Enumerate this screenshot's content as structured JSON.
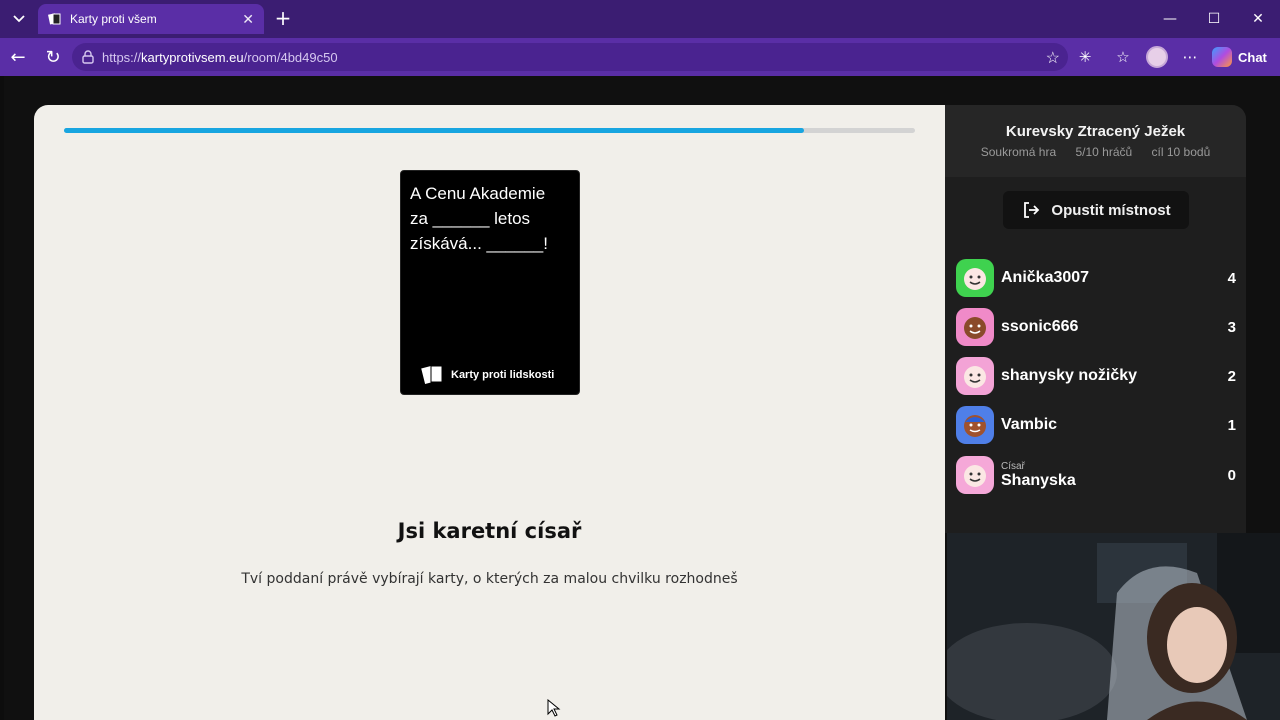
{
  "browser": {
    "tab_title": "Karty proti všem",
    "url_prefix": "https://",
    "url_host": "kartyprotivsem.eu",
    "url_path": "/room/4bd49c50",
    "chat_label": "Chat"
  },
  "game": {
    "progress": 0.87,
    "black_card_text": "A Cenu Akademie\nza ______ letos\nzískává... ______!",
    "card_brand": "Karty proti lidskosti",
    "headline": "Jsi karetní císař",
    "subline": "Tví poddaní právě vybírají karty, o kterých za malou chvilku rozhodneš"
  },
  "sidebar": {
    "room_name": "Kurevsky Ztracený Ježek",
    "room_type": "Soukromá hra",
    "players_count": "5/10 hráčů",
    "goal": "cíl 10 bodů",
    "leave_label": "Opustit místnost",
    "players": [
      {
        "name": "Anička3007",
        "score": "4",
        "role": "",
        "color": "#3fd24f"
      },
      {
        "name": "ssonic666",
        "score": "3",
        "role": "",
        "color": "#f08ac8"
      },
      {
        "name": "shanysky nožičky",
        "score": "2",
        "role": "",
        "color": "#f3a3d6"
      },
      {
        "name": "Vambic",
        "score": "1",
        "role": "",
        "color": "#4f7fe8"
      },
      {
        "name": "Shanyska",
        "score": "0",
        "role": "Císař",
        "color": "#f5a8d8"
      }
    ]
  }
}
